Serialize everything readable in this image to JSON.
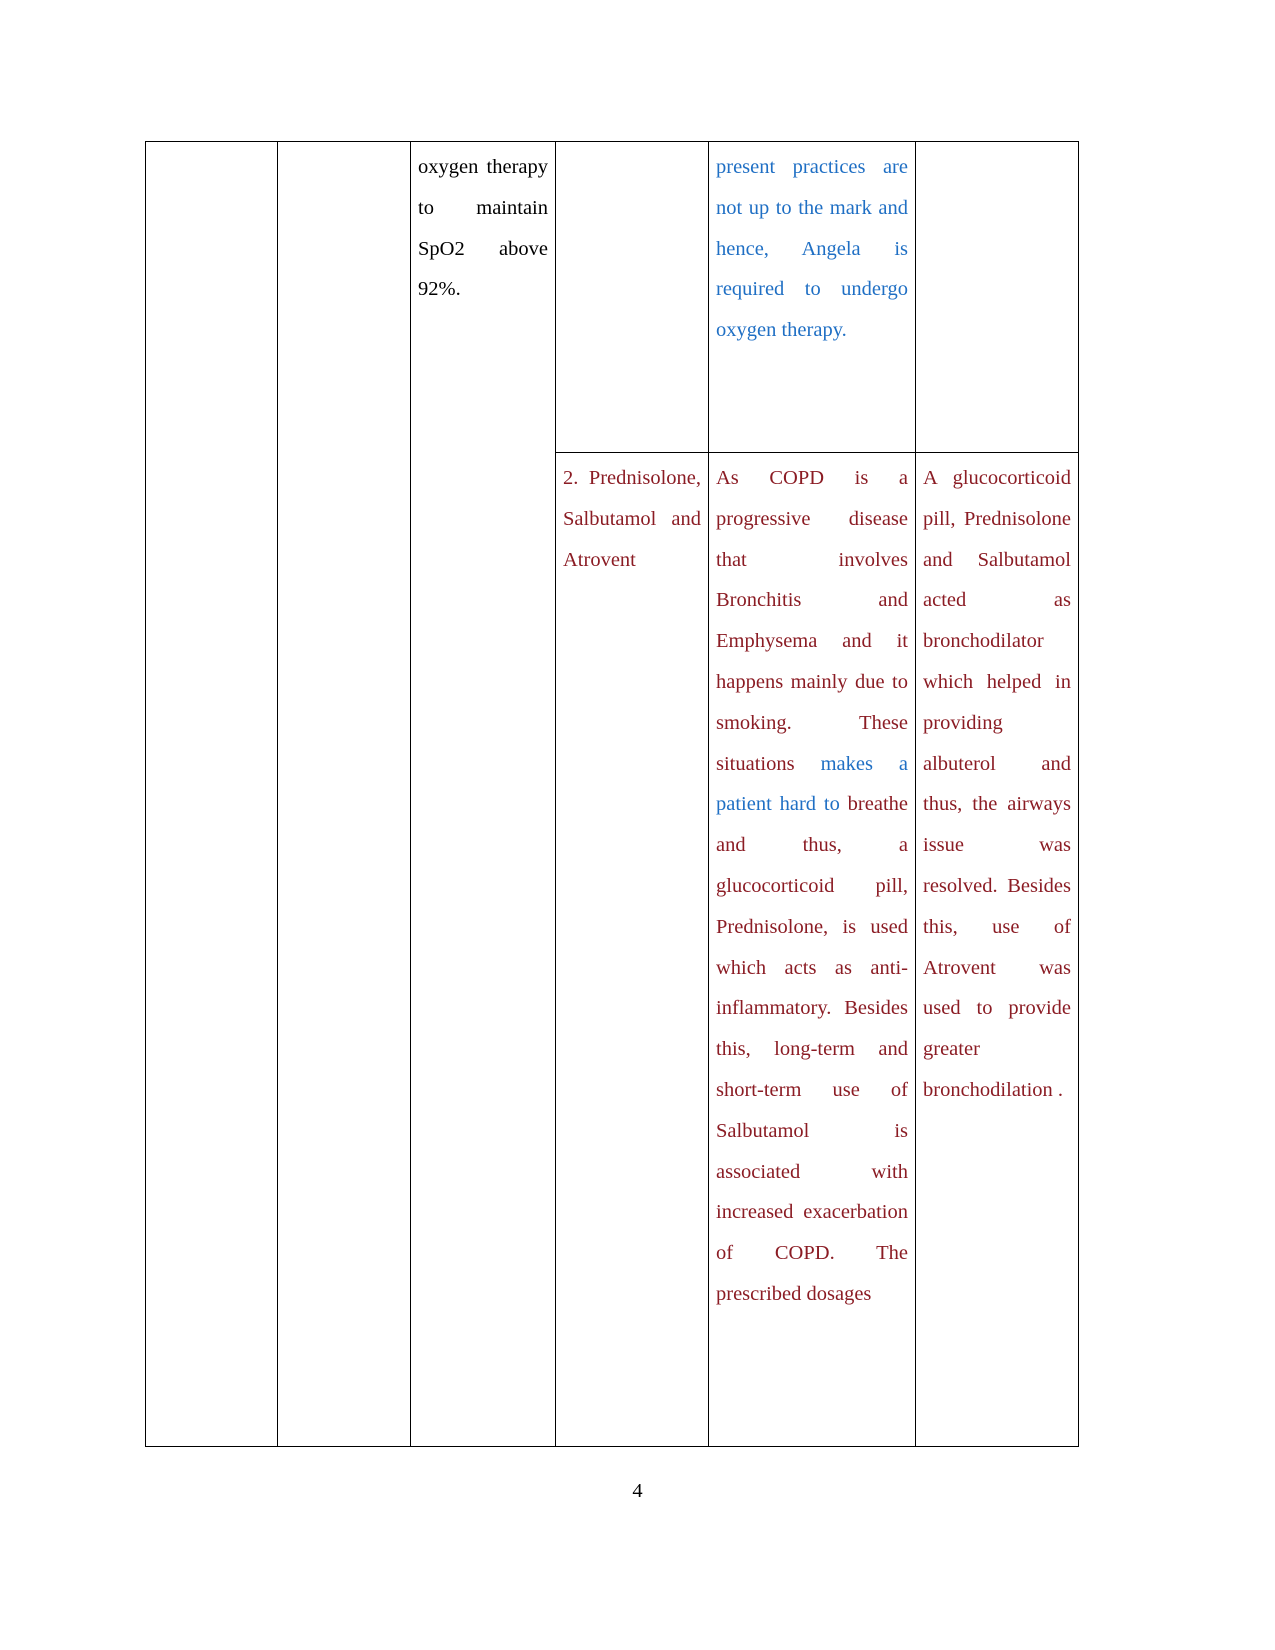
{
  "document": {
    "page_number": "4",
    "colors": {
      "black": "#000000",
      "blue": "#1f6fc4",
      "dark_red": "#8b1c24",
      "border": "#000000",
      "background": "#ffffff"
    }
  },
  "table": {
    "columns": [
      "col-a",
      "col-b",
      "col-c",
      "col-d",
      "col-e",
      "col-f"
    ],
    "rows": [
      {
        "id": "row-1-continuation",
        "cells": {
          "col_a": "",
          "col_b": "",
          "col_c_black": "oxygen therapy to maintain SpO2 above 92%.",
          "col_d": "",
          "col_e_blue": "present practices are not up to the mark and hence, Angela is required to undergo oxygen therapy.",
          "col_f": ""
        }
      },
      {
        "id": "row-2-medications",
        "cells": {
          "col_d_red": "2. Prednisolone, Salbutamol and Atrovent",
          "col_e_red_part1": "As COPD is a progressive disease that involves Bronchitis and Emphysema and it happens mainly due to smoking. These situations ",
          "col_e_blue_part": "makes a patient hard to ",
          "col_e_red_part2": "breathe and thus, a glucocorticoid pill, Prednisolone, is used which acts as anti-inflammatory. Besides this, long-term and short-term use of Salbutamol is associated with increased exacerbation of COPD. The prescribed dosages",
          "col_f_red": "A glucocorticoid pill, Prednisolone and Salbutamol acted as bronchodilator which helped in providing albuterol and thus, the airways issue was resolved. Besides this, use of Atrovent was used to provide greater bronchodilation ."
        }
      }
    ]
  }
}
